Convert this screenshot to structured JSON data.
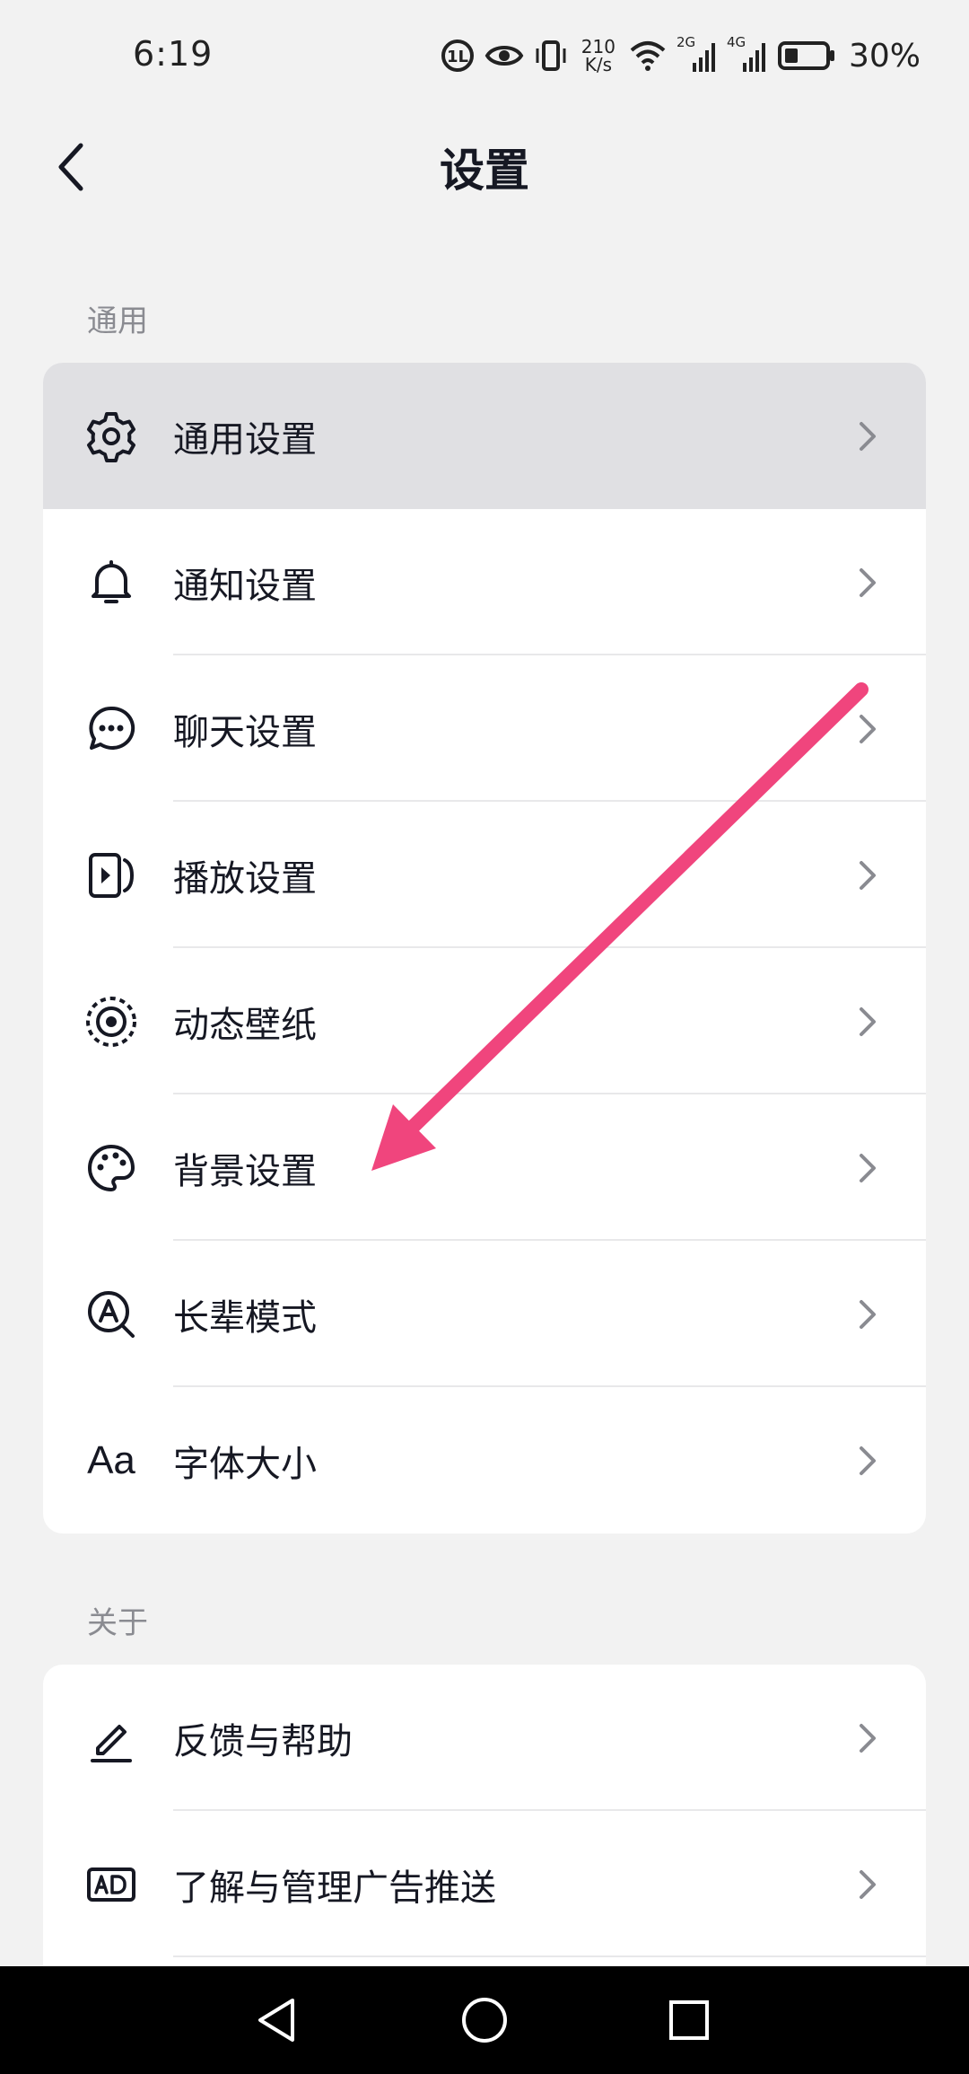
{
  "status_bar": {
    "time": "6:19",
    "net_speed_value": "210",
    "net_speed_unit": "K/s",
    "signal_1_label": "2G",
    "signal_2_label": "4G",
    "battery_percent": "30%"
  },
  "header": {
    "title": "设置"
  },
  "sections": {
    "general": {
      "label": "通用",
      "items": [
        {
          "label": "通用设置",
          "icon": "gear-icon"
        },
        {
          "label": "通知设置",
          "icon": "bell-icon"
        },
        {
          "label": "聊天设置",
          "icon": "chat-bubble-icon"
        },
        {
          "label": "播放设置",
          "icon": "play-icon"
        },
        {
          "label": "动态壁纸",
          "icon": "live-wallpaper-icon"
        },
        {
          "label": "背景设置",
          "icon": "palette-icon"
        },
        {
          "label": "长辈模式",
          "icon": "elder-mode-icon"
        },
        {
          "label": "字体大小",
          "icon": "font-size-icon",
          "glyph": "Aa"
        }
      ]
    },
    "about": {
      "label": "关于",
      "items": [
        {
          "label": "反馈与帮助",
          "icon": "edit-pen-icon"
        },
        {
          "label": "了解与管理广告推送",
          "icon": "ad-icon"
        }
      ]
    }
  },
  "colors": {
    "background": "#f2f2f2",
    "card": "#ffffff",
    "highlight_row": "#e0e0e3",
    "text": "#161823",
    "secondary_text": "#8a8b91",
    "annotation_arrow": "#f0457d"
  }
}
